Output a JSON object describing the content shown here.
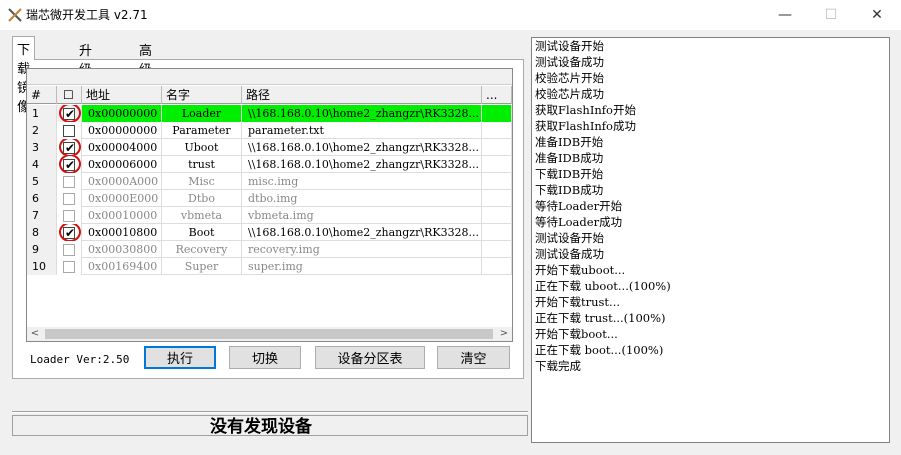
{
  "window": {
    "title": "瑞芯微开发工具 v2.71"
  },
  "tabs": [
    {
      "label": "下载镜像"
    },
    {
      "label": "升级固件"
    },
    {
      "label": "高级功能"
    }
  ],
  "table": {
    "headers": {
      "num": "#",
      "check": "☐",
      "addr": "地址",
      "name": "名字",
      "path": "路径",
      "more": "..."
    },
    "rows": [
      {
        "num": "1",
        "checked": true,
        "circled": true,
        "enabled": true,
        "highlight": true,
        "addr": "0x00000000",
        "name": "Loader",
        "path": "\\\\168.168.0.10\\home2_zhangzr\\RK3328...",
        "more": ""
      },
      {
        "num": "2",
        "checked": false,
        "circled": false,
        "enabled": true,
        "highlight": false,
        "addr": "0x00000000",
        "name": "Parameter",
        "path": "parameter.txt",
        "more": ""
      },
      {
        "num": "3",
        "checked": true,
        "circled": true,
        "enabled": true,
        "highlight": false,
        "addr": "0x00004000",
        "name": "Uboot",
        "path": "\\\\168.168.0.10\\home2_zhangzr\\RK3328...",
        "more": ""
      },
      {
        "num": "4",
        "checked": true,
        "circled": true,
        "enabled": true,
        "highlight": false,
        "addr": "0x00006000",
        "name": "trust",
        "path": "\\\\168.168.0.10\\home2_zhangzr\\RK3328...",
        "more": ""
      },
      {
        "num": "5",
        "checked": false,
        "circled": false,
        "enabled": false,
        "highlight": false,
        "addr": "0x0000A000",
        "name": "Misc",
        "path": "misc.img",
        "more": ""
      },
      {
        "num": "6",
        "checked": false,
        "circled": false,
        "enabled": false,
        "highlight": false,
        "addr": "0x0000E000",
        "name": "Dtbo",
        "path": "dtbo.img",
        "more": ""
      },
      {
        "num": "7",
        "checked": false,
        "circled": false,
        "enabled": false,
        "highlight": false,
        "addr": "0x00010000",
        "name": "vbmeta",
        "path": "vbmeta.img",
        "more": ""
      },
      {
        "num": "8",
        "checked": true,
        "circled": true,
        "enabled": true,
        "highlight": false,
        "addr": "0x00010800",
        "name": "Boot",
        "path": "\\\\168.168.0.10\\home2_zhangzr\\RK3328...",
        "more": ""
      },
      {
        "num": "9",
        "checked": false,
        "circled": false,
        "enabled": false,
        "highlight": false,
        "addr": "0x00030800",
        "name": "Recovery",
        "path": "recovery.img",
        "more": ""
      },
      {
        "num": "10",
        "checked": false,
        "circled": false,
        "enabled": false,
        "highlight": false,
        "addr": "0x00169400",
        "name": "Super",
        "path": "super.img",
        "more": ""
      }
    ]
  },
  "loader_version": "Loader Ver:2.50",
  "buttons": {
    "run": "执行",
    "switch": "切换",
    "partition_table": "设备分区表",
    "clear": "清空"
  },
  "status": "没有发现设备",
  "log": [
    "测试设备开始",
    "测试设备成功",
    "校验芯片开始",
    "校验芯片成功",
    "获取FlashInfo开始",
    "获取FlashInfo成功",
    "准备IDB开始",
    "准备IDB成功",
    "下载IDB开始",
    "下载IDB成功",
    "等待Loader开始",
    "等待Loader成功",
    "测试设备开始",
    "测试设备成功",
    "开始下载uboot...",
    "正在下载 uboot...(100%)",
    "开始下载trust...",
    "正在下载 trust...(100%)",
    "开始下载boot...",
    "正在下载 boot...(100%)",
    "下载完成"
  ],
  "colors": {
    "highlight_row": "#00ee00",
    "circle_mark": "#d01010",
    "focus_border": "#0078d7"
  }
}
